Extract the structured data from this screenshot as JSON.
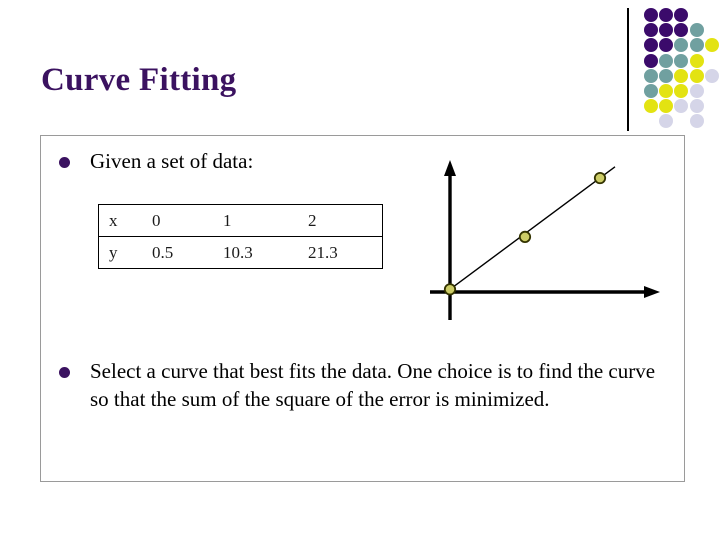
{
  "slide": {
    "title": "Curve Fitting",
    "title_color": "#3B1260",
    "bullet_color": "#3B1260",
    "background": "#ffffff"
  },
  "bullets": [
    {
      "marker": "disc-bullet",
      "text": "Given a set of data:"
    },
    {
      "marker": "disc-bullet",
      "text": "Select a curve that best fits the data. One choice is to find the curve so that the sum of the square of the error is minimized."
    }
  ],
  "table": {
    "rows": [
      {
        "label": "x",
        "values": [
          "0",
          "1",
          "2"
        ]
      },
      {
        "label": "y",
        "values": [
          "0.5",
          "10.3",
          "21.3"
        ]
      }
    ]
  },
  "chart_data": {
    "type": "scatter",
    "title": "",
    "xlabel": "",
    "ylabel": "",
    "grid": false,
    "legend": null,
    "axes": {
      "style": "arrow-axes",
      "origin_x": 0,
      "origin_y": 0,
      "xlim": [
        -0.25,
        2.75
      ],
      "ylim": [
        -3.0,
        26.0
      ]
    },
    "x": [
      0,
      1,
      2
    ],
    "y": [
      0.5,
      10.3,
      21.3
    ],
    "series": [
      {
        "name": "data points",
        "type": "scatter",
        "marker": "circle",
        "marker_fill": "#CCCC66",
        "marker_edge": "#333300",
        "x": [
          0,
          1,
          2
        ],
        "y": [
          0.5,
          10.3,
          21.3
        ]
      },
      {
        "name": "best fit line",
        "type": "line",
        "color": "#000000",
        "x": [
          0,
          2.2
        ],
        "y": [
          0.5,
          23.4
        ]
      }
    ]
  },
  "decor": {
    "dot_grid_name": "decorative-dot-grid",
    "colors": {
      "purple": "#3B0B6B",
      "teal": "#70A0A0",
      "yellow": "#E3E312",
      "lavender": "#D5D5E8"
    },
    "pattern": [
      [
        "purple",
        "purple",
        "purple",
        null,
        null
      ],
      [
        "purple",
        "purple",
        "purple",
        "teal",
        null
      ],
      [
        "purple",
        "purple",
        "teal",
        "teal",
        "yellow"
      ],
      [
        "purple",
        "teal",
        "teal",
        "yellow",
        null
      ],
      [
        "teal",
        "teal",
        "yellow",
        "yellow",
        "lavender"
      ],
      [
        "teal",
        "yellow",
        "yellow",
        "lavender",
        null
      ],
      [
        "yellow",
        "yellow",
        "lavender",
        "lavender",
        null
      ],
      [
        null,
        "lavender",
        null,
        "lavender",
        null
      ]
    ]
  }
}
